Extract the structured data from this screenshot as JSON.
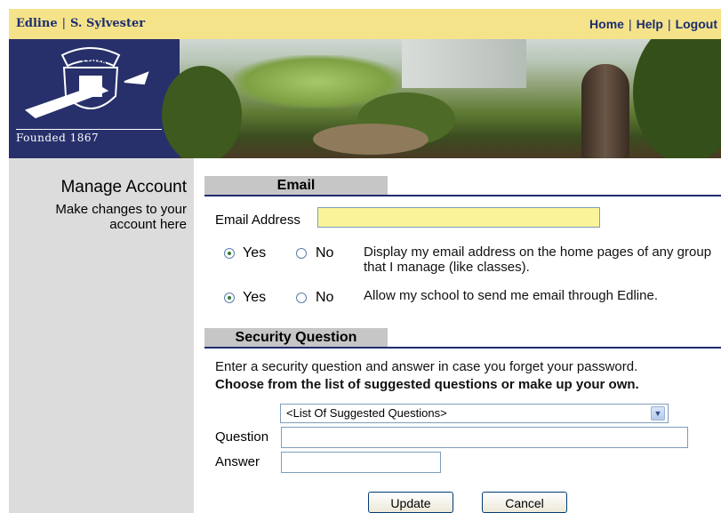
{
  "topbar": {
    "site": "Edline",
    "school": "S. Sylvester",
    "links": [
      "Home",
      "Help",
      "Logout"
    ]
  },
  "banner": {
    "founded": "Founded 1867",
    "colors": {
      "navy": "#27306a",
      "gold": "#f5e38a"
    }
  },
  "sidebar": {
    "title": "Manage Account",
    "subtitle": "Make changes to your account here"
  },
  "email_section": {
    "heading": "Email",
    "address_label": "Email Address",
    "address_value": "",
    "display_option": {
      "yes_label": "Yes",
      "no_label": "No",
      "selected": "Yes",
      "description": "Display my email address on the home pages of any group that I manage (like classes)."
    },
    "school_option": {
      "yes_label": "Yes",
      "no_label": "No",
      "selected": "Yes",
      "description": "Allow my school to send me email through Edline."
    }
  },
  "security_section": {
    "heading": "Security Question",
    "instructions": "Enter a security question and answer in case you forget your password.",
    "instructions_bold": "Choose from the list of suggested questions or make up your own.",
    "suggested_select": "<List Of Suggested Questions>",
    "question_label": "Question",
    "question_value": "",
    "answer_label": "Answer",
    "answer_value": ""
  },
  "buttons": {
    "update": "Update",
    "cancel": "Cancel"
  }
}
